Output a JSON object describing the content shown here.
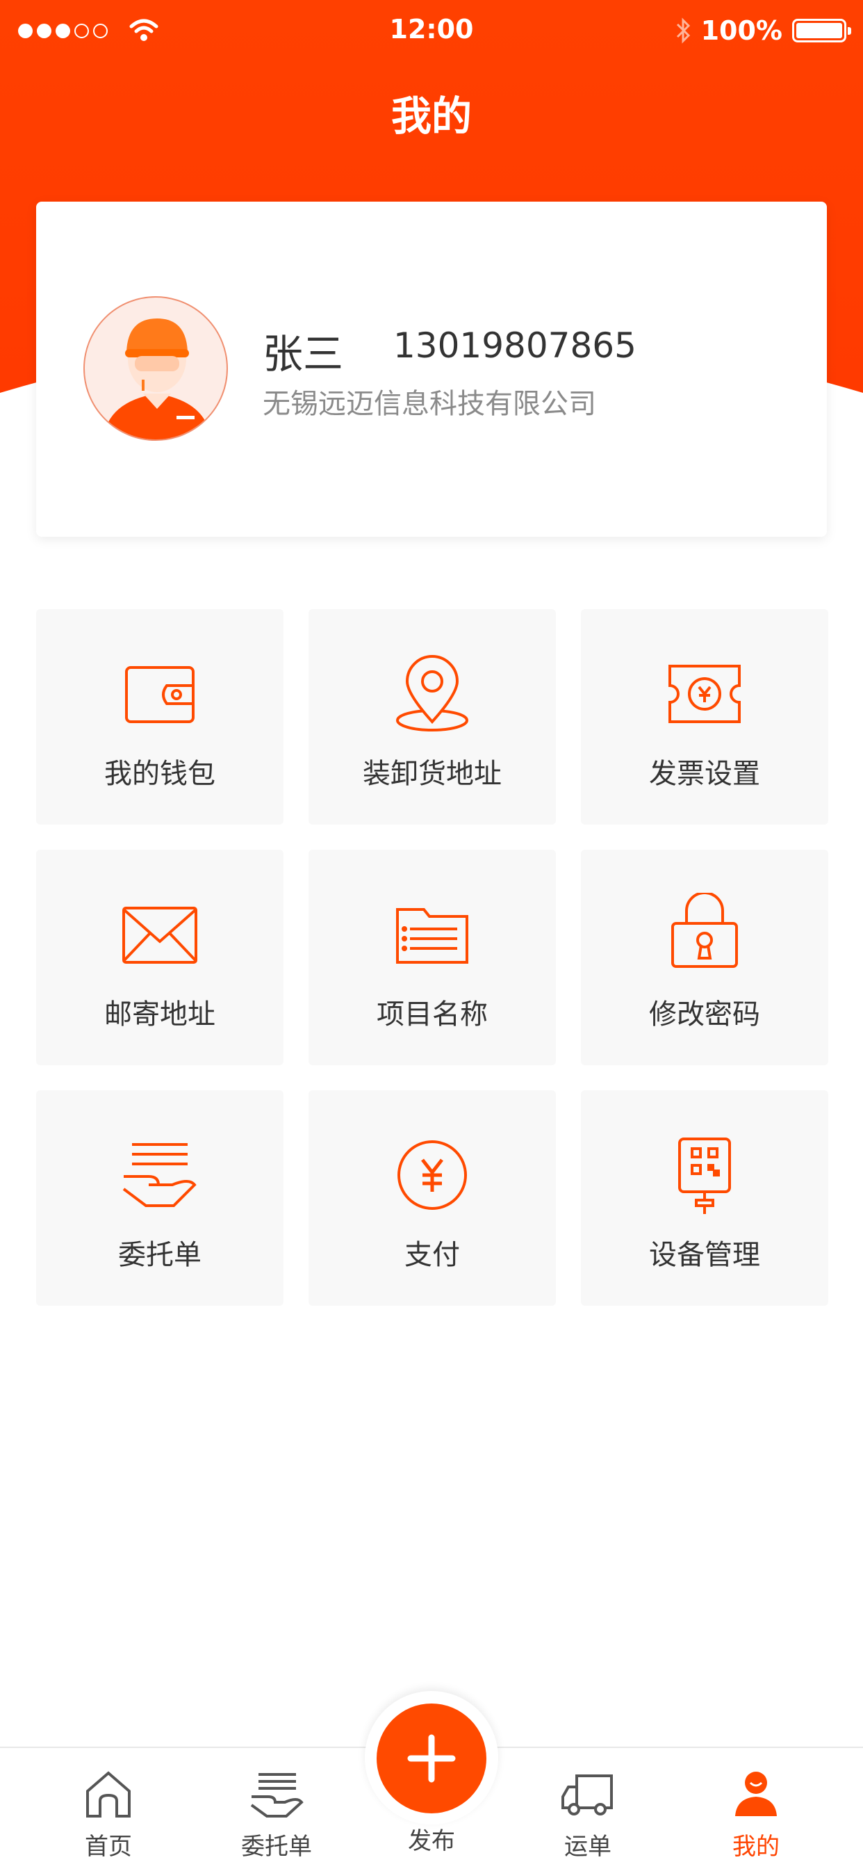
{
  "status_bar": {
    "time": "12:00",
    "battery": "100%"
  },
  "header": {
    "title": "我的"
  },
  "profile": {
    "name": "张三",
    "phone": "13019807865",
    "company": "无锡远迈信息科技有限公司"
  },
  "menu": [
    {
      "label": "我的钱包",
      "icon": "wallet-icon"
    },
    {
      "label": "装卸货地址",
      "icon": "location-pin-icon"
    },
    {
      "label": "发票设置",
      "icon": "invoice-ticket-icon"
    },
    {
      "label": "邮寄地址",
      "icon": "envelope-icon"
    },
    {
      "label": "项目名称",
      "icon": "folder-icon"
    },
    {
      "label": "修改密码",
      "icon": "lock-icon"
    },
    {
      "label": "委托单",
      "icon": "hand-document-icon"
    },
    {
      "label": "支付",
      "icon": "yen-coin-icon"
    },
    {
      "label": "设备管理",
      "icon": "qr-device-icon"
    }
  ],
  "tabbar": {
    "home": "首页",
    "orders": "委托单",
    "publish": "发布",
    "waybill": "运单",
    "mine": "我的"
  },
  "colors": {
    "brand": "#ff3c00",
    "accent": "#ff4a00",
    "tile_bg": "#f8f8f8"
  }
}
